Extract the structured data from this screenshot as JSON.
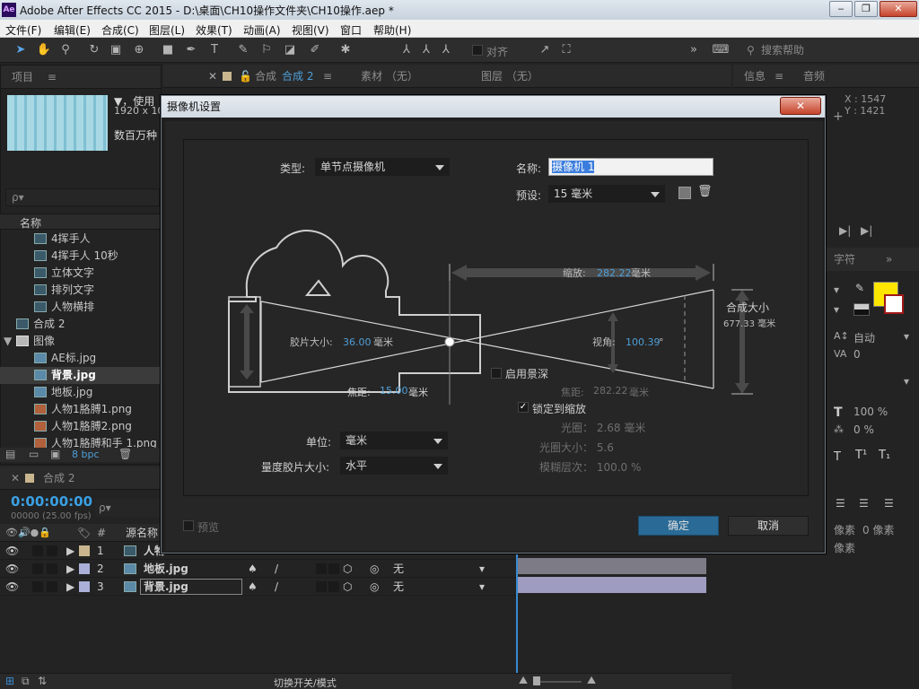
{
  "window": {
    "app_icon": "Ae",
    "title": "Adobe After Effects CC 2015 - D:\\桌面\\CH10操作文件夹\\CH10操作.aep *"
  },
  "menu": [
    "文件(F)",
    "编辑(E)",
    "合成(C)",
    "图层(L)",
    "效果(T)",
    "动画(A)",
    "视图(V)",
    "窗口",
    "帮助(H)"
  ],
  "toolbar": {
    "align_label": "对齐",
    "search_placeholder": "搜索帮助"
  },
  "project": {
    "header": "项目",
    "info_line1": "▼，使用",
    "info_line2": "1920 x 108",
    "info_line3": "数百万种",
    "search_placeholder": "ρ▾",
    "col_name": "名称",
    "items": [
      {
        "label": "4挥手人",
        "indent": 2
      },
      {
        "label": "4挥手人 10秒",
        "indent": 2
      },
      {
        "label": "立体文字",
        "indent": 2
      },
      {
        "label": "排列文字",
        "indent": 2
      },
      {
        "label": "人物横排",
        "indent": 2
      },
      {
        "label": "合成 2",
        "indent": 1
      },
      {
        "label": "图像",
        "indent": 0
      },
      {
        "label": "AE标.jpg",
        "indent": 2
      },
      {
        "label": "背景.jpg",
        "indent": 2
      },
      {
        "label": "地板.jpg",
        "indent": 2
      },
      {
        "label": "人物1胳膊1.png",
        "indent": 2
      },
      {
        "label": "人物1胳膊2.png",
        "indent": 2
      },
      {
        "label": "人物1胳膊和手 1.png",
        "indent": 2
      }
    ],
    "footer_bpc": "8 bpc"
  },
  "comp_panel": {
    "tab_comp": "合成",
    "tab_comp_name": "合成 2",
    "tab_footage": "素材 （无）",
    "tab_layer": "图层 （无）"
  },
  "info_panel": {
    "tab_info": "信息",
    "tab_audio": "音频",
    "x": "X : 1547",
    "y": "Y : 1421"
  },
  "char_panel": {
    "tab": "字符",
    "auto": "自动",
    "tracking": "0",
    "scale1": "100 %",
    "scale2": "0 %",
    "pixels1": "像素",
    "pixels2": "0 像素",
    "pixels3": "像素"
  },
  "timeline": {
    "tab": "合成 2",
    "timecode": "0:00:00:00",
    "timecode_sub": "00000 (25.00 fps)",
    "col_source": "源名称",
    "hash": "#",
    "layers": [
      {
        "num": "1",
        "name": "人物",
        "mode": ""
      },
      {
        "num": "2",
        "name": "地板.jpg",
        "mode": "无"
      },
      {
        "num": "3",
        "name": "背景.jpg",
        "mode": "无"
      }
    ],
    "footer_toggle": "切换开关/模式"
  },
  "dialog": {
    "title": "摄像机设置",
    "close": "✕",
    "type_label": "类型:",
    "type_value": "单节点摄像机",
    "name_label": "名称:",
    "name_value": "摄像机 1",
    "preset_label": "预设:",
    "preset_value": "15 毫米",
    "zoom_label": "缩放:",
    "zoom_value": "282.22",
    "zoom_unit": "毫米",
    "film_label": "胶片大小:",
    "film_value": "36.00",
    "film_unit": "毫米",
    "angle_label": "视角:",
    "angle_value": "100.39",
    "angle_unit": "°",
    "comp_size_label": "合成大小",
    "comp_size_value": "677.33 毫米",
    "focal_label": "焦距:",
    "focal_value": "15.00",
    "focal_unit": "毫米",
    "focus_dist_label": "焦距:",
    "focus_dist_value": "282.22",
    "focus_dist_unit": "毫米",
    "dof_label": "启用景深",
    "lock_zoom_label": "锁定到缩放",
    "aperture": "光圈： 2.68 毫米",
    "fstop": "光圈大小： 5.6",
    "blur": "模糊层次： 100.0 %",
    "units_label": "单位:",
    "units_value": "毫米",
    "measure_label": "量度胶片大小:",
    "measure_value": "水平",
    "preview_label": "预览",
    "ok": "确定",
    "cancel": "取消"
  }
}
